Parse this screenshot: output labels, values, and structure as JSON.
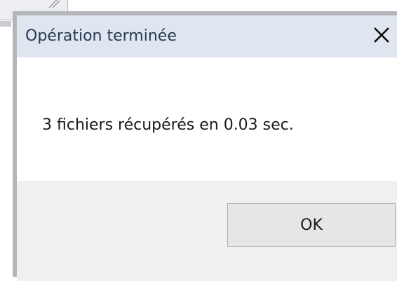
{
  "dialog": {
    "title": "Opération terminée",
    "close_icon": "close-icon",
    "message": "3 fichiers récupérés en 0.03 sec.",
    "ok_label": "OK"
  },
  "colors": {
    "title_bar": "#dfe6ef",
    "title_text": "#2b3a55",
    "content_background": "#ffffff",
    "footer_background": "#f0f0f0",
    "button_background": "#e6e6e6",
    "button_border": "#adadad",
    "window_border": "#b4b6ba"
  }
}
